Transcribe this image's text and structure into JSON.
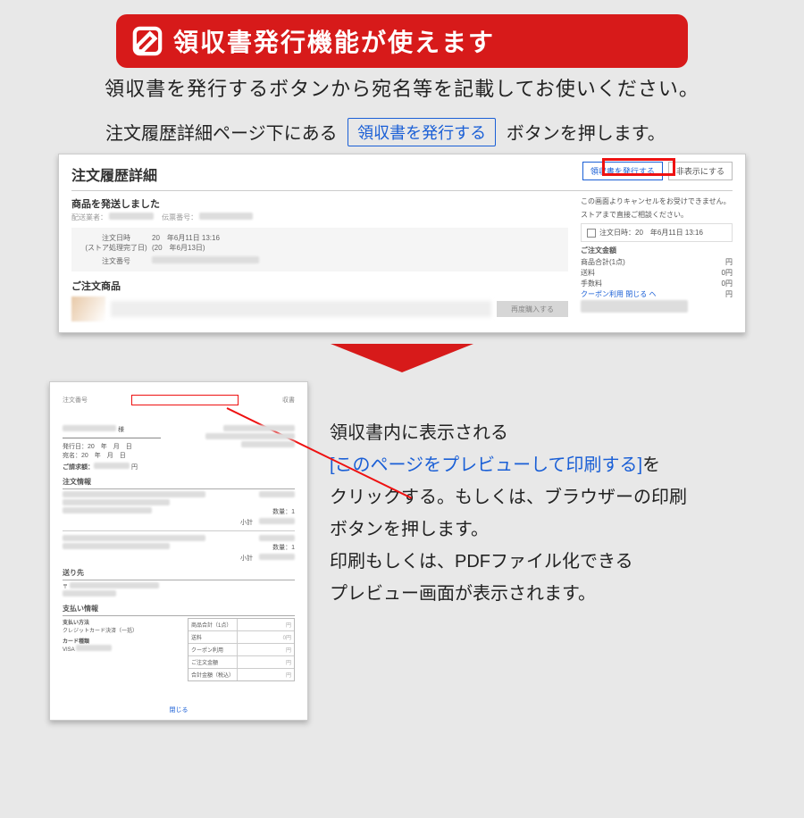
{
  "banner": {
    "title": "領収書発行機能が使えます"
  },
  "subtitle": "領収書を発行するボタンから宛名等を記載してお使いください。",
  "instr1": {
    "before": "注文履歴詳細ページ下にある",
    "button": "領収書を発行する",
    "after": "ボタンを押します。"
  },
  "panel1": {
    "title": "注文履歴詳細",
    "issue_btn": "領収書を発行する",
    "hide_btn": "非表示にする",
    "shipped": "商品を発送しました",
    "carrier_label": "配送業者：",
    "slip_label": "伝票番号：",
    "order_date_label": "注文日時\n(ストア処理完了日)",
    "order_date_val": "20　年6月11日 13:16\n(20　年6月13日)",
    "order_no_label": "注文番号",
    "ordered_title": "ご注文商品",
    "rebuy": "再度購入する",
    "note1": "この画面よりキャンセルをお受けできません。",
    "note2": "ストアまで直接ご相談ください。",
    "date_badge": "注文日時：20　年6月11日 13:16",
    "sum_title": "ご注文金額",
    "sum_rows": [
      {
        "l": "商品合計(1点)",
        "r": "円"
      },
      {
        "l": "送料",
        "r": "0円"
      },
      {
        "l": "手数料",
        "r": "0円"
      },
      {
        "l": "クーポン利用 閉じる ヘ",
        "r": "円"
      }
    ]
  },
  "doc": {
    "order_no_label": "注文番号",
    "receipt_word": "収書",
    "sama": "様",
    "meta1": "発行日：20　年　月　日",
    "meta2": "宛名：20　年　月　日",
    "billing_label": "ご請求額：",
    "yen": "円",
    "sec_order": "注文情報",
    "row_qty": "数量：1",
    "row_sub": "小計",
    "sec_addr": "送り先",
    "sec_pay": "支払い情報",
    "pay_method_l": "支払い方法",
    "pay_method_v": "クレジットカード決済（一括）",
    "card_l": "カード種類",
    "card_v": "VISA",
    "tbl": [
      {
        "l": "商品合計（1点）",
        "r": "円"
      },
      {
        "l": "送料",
        "r": "0円"
      },
      {
        "l": "クーポン利用",
        "r": "円"
      },
      {
        "l": "ご注文金額",
        "r": "円"
      },
      {
        "l": "合計金額（税込）",
        "r": "円"
      }
    ],
    "page": "閉じる"
  },
  "step2": {
    "line1": "領収書内に表示される",
    "blue": "[このページをプレビューして印刷する]",
    "line2a": "を",
    "line3": "クリックする。もしくは、ブラウザーの印刷",
    "line4": "ボタンを押します。",
    "line5": "印刷もしくは、PDFファイル化できる",
    "line6": "プレビュー画面が表示されます。"
  }
}
